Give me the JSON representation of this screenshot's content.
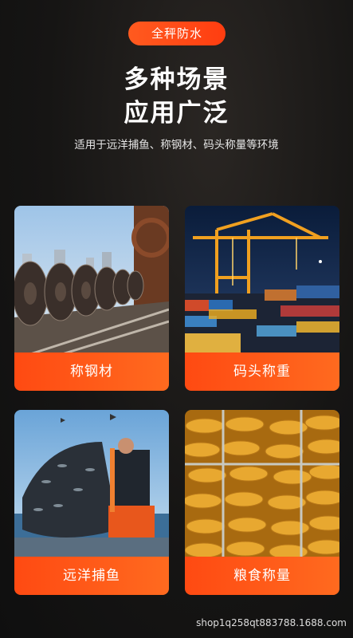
{
  "badge": "全秤防水",
  "title_line1": "多种场景",
  "title_line2": "应用广泛",
  "subtitle": "适用于远洋捕鱼、称钢材、码头称量等环境",
  "cards": [
    {
      "label": "称钢材"
    },
    {
      "label": "码头称重"
    },
    {
      "label": "远洋捕鱼"
    },
    {
      "label": "粮食称量"
    }
  ],
  "watermark": "shop1q258qt883788.1688.com",
  "colors": {
    "accent": "#ff4a12",
    "background": "#161514"
  }
}
